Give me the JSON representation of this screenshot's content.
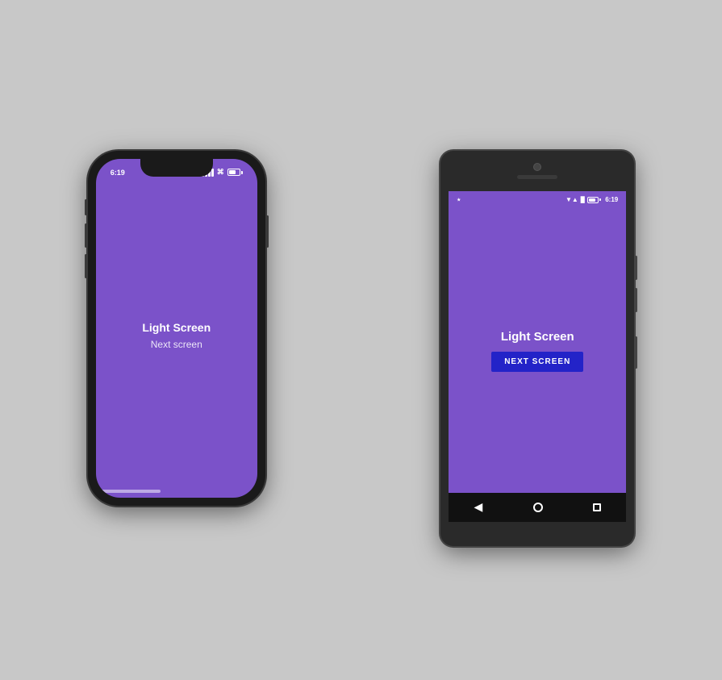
{
  "background": "#c8c8c8",
  "accent_purple": "#7b52c9",
  "iphone": {
    "time": "6:19",
    "screen_title": "Light Screen",
    "screen_subtitle": "Next screen",
    "screen_bg": "#7b52c9"
  },
  "android": {
    "time": "6:19",
    "screen_title": "Light Screen",
    "next_button_label": "NEXT SCREEN",
    "screen_bg": "#7b52c9",
    "nav": {
      "back": "◀",
      "home": "",
      "recents": ""
    }
  }
}
